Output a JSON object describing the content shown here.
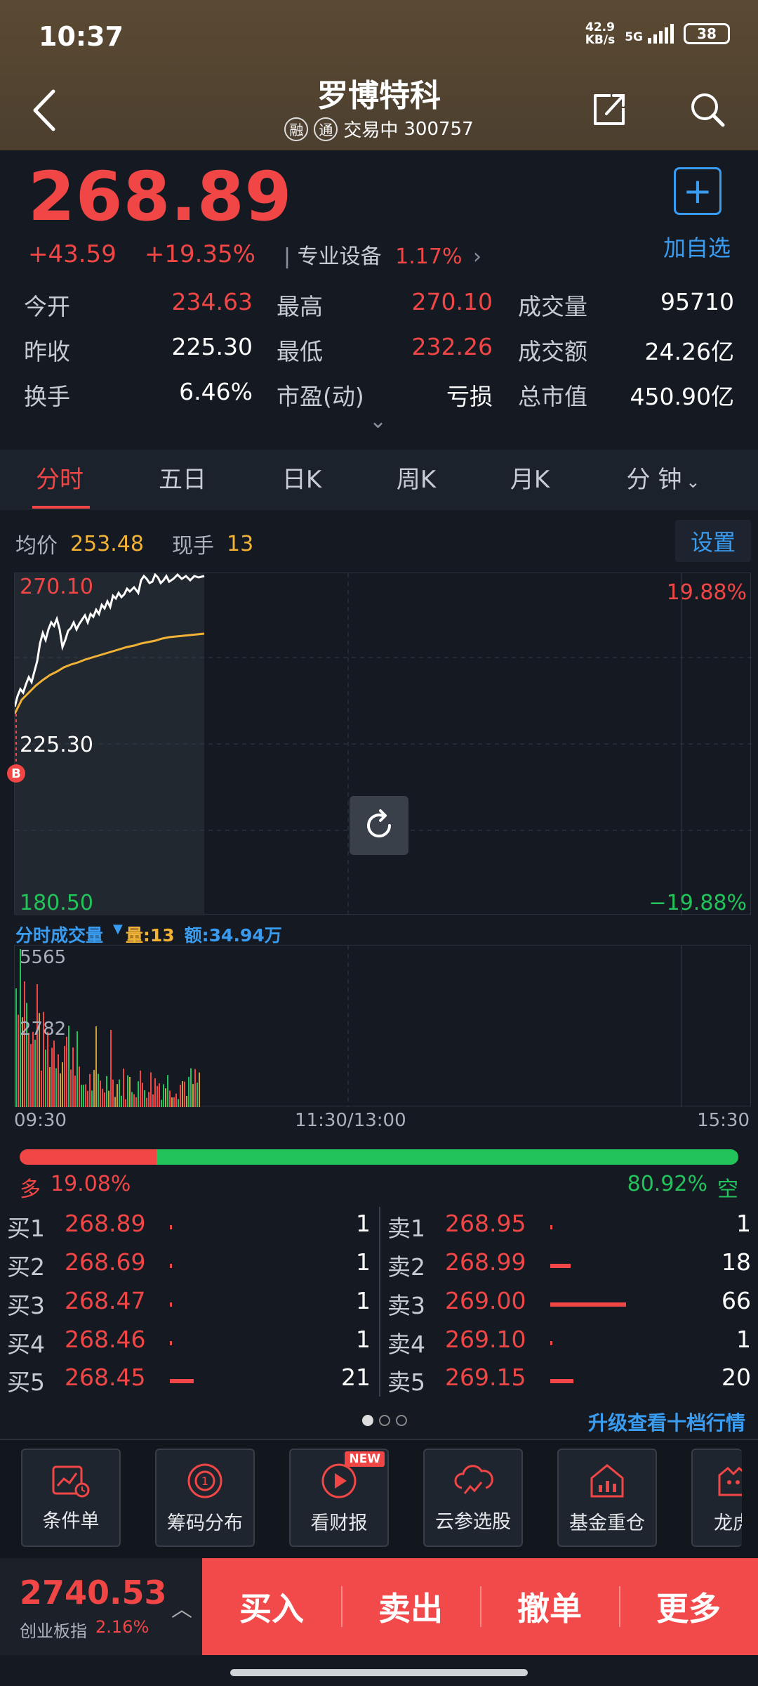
{
  "status": {
    "time": "10:37",
    "net_speed_value": "42.9",
    "net_speed_unit": "KB/s",
    "network": "5G",
    "battery": "38"
  },
  "header": {
    "title": "罗博特科",
    "badge1": "融",
    "badge2": "通",
    "trading_status": "交易中",
    "code": "300757"
  },
  "quote": {
    "price": "268.89",
    "change": "+43.59",
    "change_pct": "+19.35%",
    "sector_name": "专业设备",
    "sector_pct": "1.17%",
    "add_fav_label": "加自选",
    "stats": [
      {
        "label": "今开",
        "value": "234.63",
        "color": "red"
      },
      {
        "label": "最高",
        "value": "270.10",
        "color": "red"
      },
      {
        "label": "成交量",
        "value": "95710",
        "color": "white"
      },
      {
        "label": "昨收",
        "value": "225.30",
        "color": "white"
      },
      {
        "label": "最低",
        "value": "232.26",
        "color": "red"
      },
      {
        "label": "成交额",
        "value": "24.26亿",
        "color": "white"
      },
      {
        "label": "换手",
        "value": "6.46%",
        "color": "white"
      },
      {
        "label": "市盈(动)",
        "value": "亏损",
        "color": "white"
      },
      {
        "label": "总市值",
        "value": "450.90亿",
        "color": "white"
      }
    ]
  },
  "tabs": [
    "分时",
    "五日",
    "日K",
    "周K",
    "月K",
    "分 钟"
  ],
  "chart": {
    "avg_label": "均价",
    "avg_value": "253.48",
    "vol_label": "现手",
    "vol_value": "13",
    "settings_label": "设置",
    "high_price": "270.10",
    "prev_close": "225.30",
    "low_price": "180.50",
    "high_pct": "19.88%",
    "low_pct": "−19.88%",
    "marker": "B",
    "volume_title": "分时成交量",
    "volume_qty_label": "量:13",
    "volume_amt_label": "额:34.94万",
    "vol_max": "5565",
    "vol_mid": "2782",
    "time_start": "09:30",
    "time_mid": "11:30/13:00",
    "time_end": "15:30"
  },
  "sentiment": {
    "bull_label": "多",
    "bull_pct": "19.08%",
    "bear_pct": "80.92%",
    "bear_label": "空",
    "bull_value": 19.08
  },
  "orderbook": {
    "bids": [
      {
        "label": "买1",
        "price": "268.89",
        "qty": "1"
      },
      {
        "label": "买2",
        "price": "268.69",
        "qty": "1"
      },
      {
        "label": "买3",
        "price": "268.47",
        "qty": "1"
      },
      {
        "label": "买4",
        "price": "268.46",
        "qty": "1"
      },
      {
        "label": "买5",
        "price": "268.45",
        "qty": "21"
      }
    ],
    "asks": [
      {
        "label": "卖1",
        "price": "268.95",
        "qty": "1"
      },
      {
        "label": "卖2",
        "price": "268.99",
        "qty": "18"
      },
      {
        "label": "卖3",
        "price": "269.00",
        "qty": "66"
      },
      {
        "label": "卖4",
        "price": "269.10",
        "qty": "1"
      },
      {
        "label": "卖5",
        "price": "269.15",
        "qty": "20"
      }
    ],
    "upgrade_label": "升级查看十档行情>"
  },
  "tools": [
    {
      "label": "条件单",
      "icon": "chart-clock-icon"
    },
    {
      "label": "筹码分布",
      "icon": "chip-icon"
    },
    {
      "label": "看财报",
      "icon": "play-icon",
      "badge": "NEW"
    },
    {
      "label": "云参选股",
      "icon": "cloud-icon"
    },
    {
      "label": "基金重仓",
      "icon": "house-chart-icon"
    },
    {
      "label": "龙虎",
      "icon": "tiger-icon"
    }
  ],
  "bottom": {
    "index_value": "2740.53",
    "index_name": "创业板指",
    "index_pct": "2.16%",
    "actions": [
      "买入",
      "卖出",
      "撤单",
      "更多"
    ]
  }
}
